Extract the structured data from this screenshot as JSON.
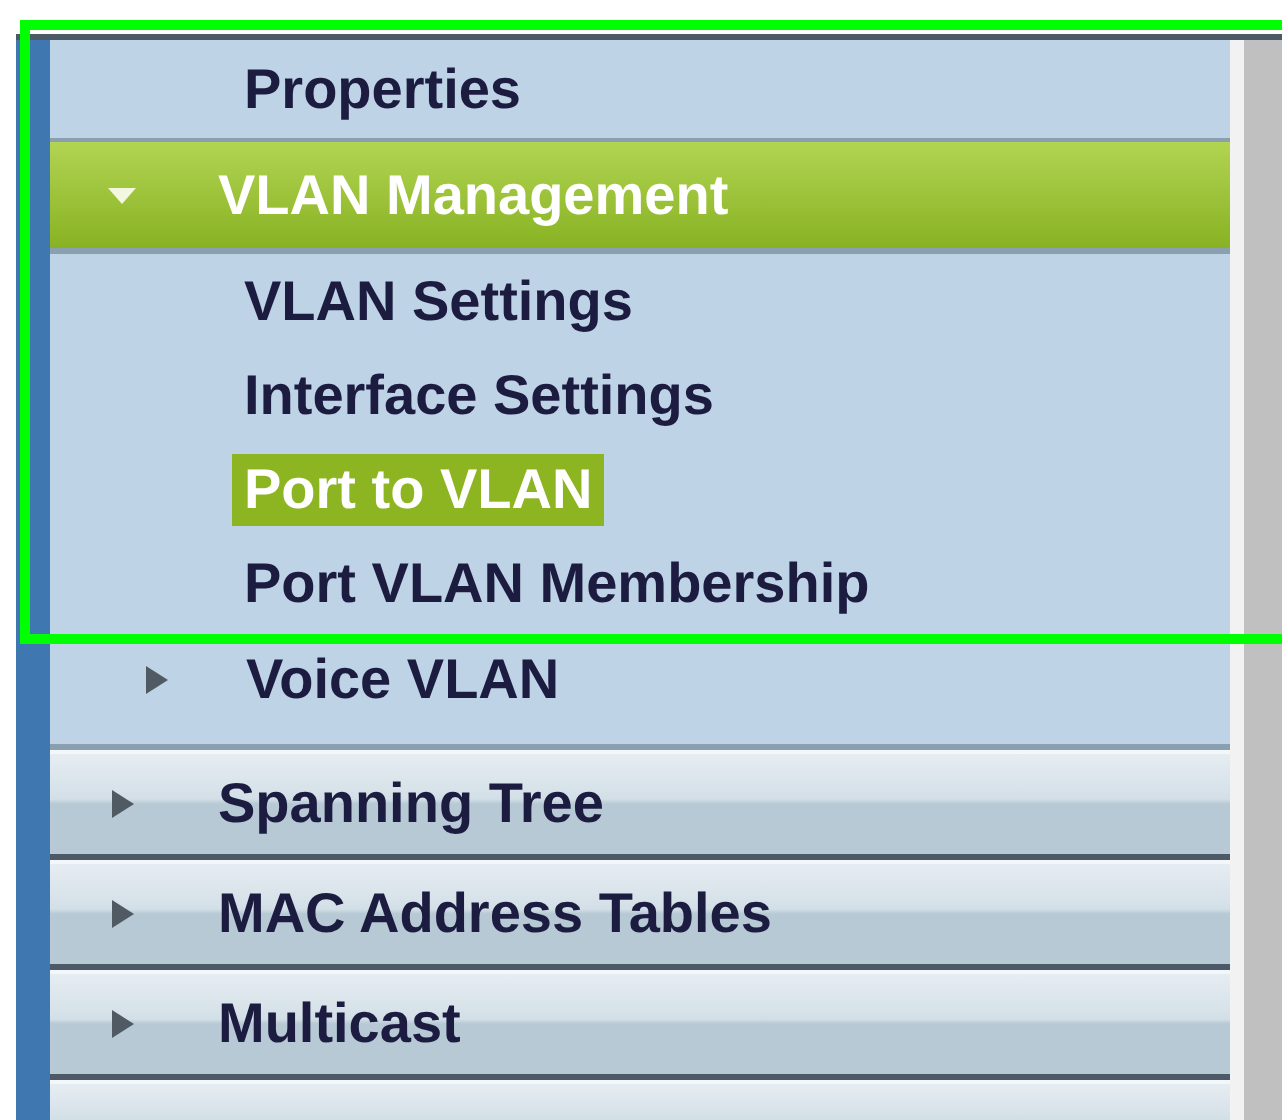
{
  "menu": {
    "items": [
      {
        "kind": "subitem",
        "label": "Properties",
        "selected": false
      },
      {
        "kind": "section",
        "label": "VLAN Management",
        "expanded": true,
        "children": [
          {
            "kind": "subitem",
            "label": "VLAN Settings",
            "selected": false
          },
          {
            "kind": "subitem",
            "label": "Interface Settings",
            "selected": false
          },
          {
            "kind": "subitem",
            "label": "Port to VLAN",
            "selected": true
          },
          {
            "kind": "subitem",
            "label": "Port VLAN Membership",
            "selected": false
          },
          {
            "kind": "subgroup",
            "label": "Voice VLAN",
            "expanded": false
          }
        ]
      },
      {
        "kind": "section",
        "label": "Spanning Tree",
        "expanded": false
      },
      {
        "kind": "section",
        "label": "MAC Address Tables",
        "expanded": false
      },
      {
        "kind": "section",
        "label": "Multicast",
        "expanded": false
      }
    ]
  }
}
